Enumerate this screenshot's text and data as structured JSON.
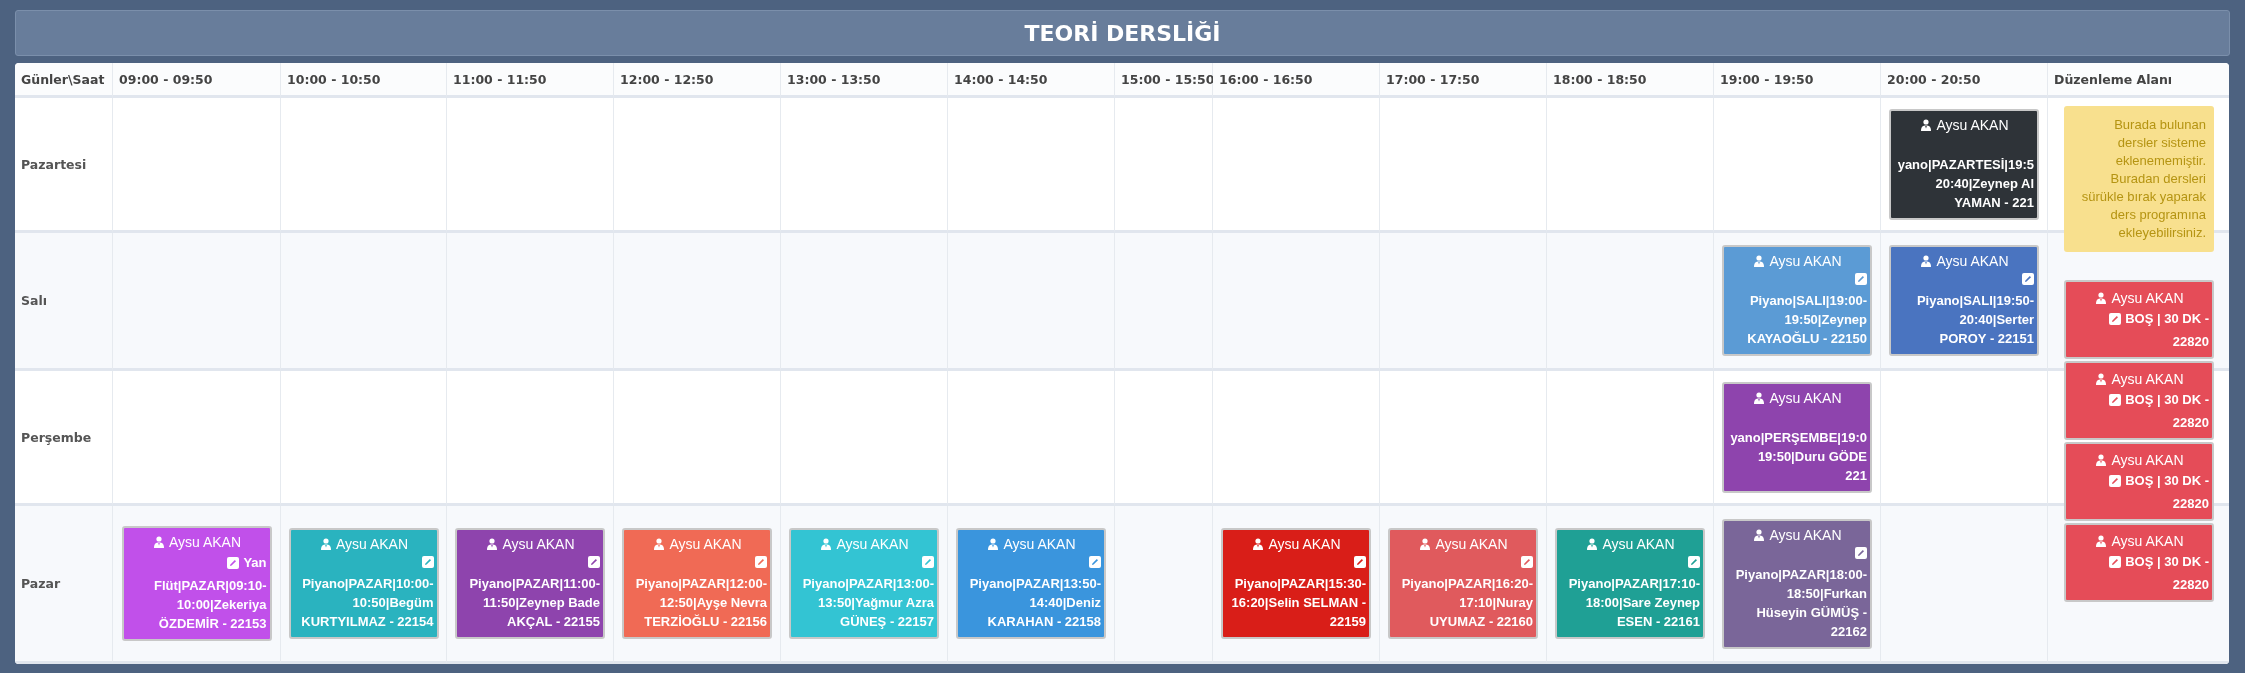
{
  "title": "TEORİ DERSLİĞİ",
  "columns": [
    "Günler\\Saat",
    "09:00 - 09:50",
    "10:00 - 10:50",
    "11:00 - 11:50",
    "12:00 - 12:50",
    "13:00 - 13:50",
    "14:00 - 14:50",
    "15:00 - 15:50",
    "16:00 - 16:50",
    "17:00 - 17:50",
    "18:00 - 18:50",
    "19:00 - 19:50",
    "20:00 - 20:50",
    "Düzenleme Alanı"
  ],
  "rows": [
    {
      "day": "Pazartesi",
      "cells": [
        {},
        {},
        {},
        {},
        {},
        {},
        {},
        {},
        {},
        {},
        {},
        {
          "lesson": {
            "teacher": "Aysu AKAN",
            "kind": "none",
            "color": "#2e3338",
            "text": "yano|PAZARTESİ|19:5\n20:40|Zeynep Al\nYAMAN - 221"
          }
        }
      ]
    },
    {
      "day": "Salı",
      "cells": [
        {},
        {},
        {},
        {},
        {},
        {},
        {},
        {},
        {},
        {},
        {
          "lesson": {
            "teacher": "Aysu AKAN",
            "kind": "own_line",
            "color": "#5b9bd5",
            "text": "Piyano|SALI|19:00-\n19:50|Zeynep\nKAYAOĞLU - 22150"
          }
        },
        {
          "lesson": {
            "teacher": "Aysu AKAN",
            "kind": "own_line",
            "color": "#4a74c0",
            "text": "Piyano|SALI|19:50-\n20:40|Serter\nPOROY - 22151"
          }
        }
      ]
    },
    {
      "day": "Perşembe",
      "cells": [
        {},
        {},
        {},
        {},
        {},
        {},
        {},
        {},
        {},
        {},
        {
          "lesson": {
            "teacher": "Aysu AKAN",
            "kind": "none",
            "color": "#8e44ad",
            "text": "yano|PERŞEMBE|19:0\n19:50|Duru GÖDE\n221"
          }
        },
        {}
      ]
    },
    {
      "day": "Pazar",
      "cells": [
        {
          "lesson": {
            "teacher": "Aysu AKAN",
            "kind": "inline",
            "color": "#c150ea",
            "first_line": "Yan",
            "text": "Flüt|PAZAR|09:10-\n10:00|Zekeriya\nÖZDEMİR - 22153"
          }
        },
        {
          "lesson": {
            "teacher": "Aysu AKAN",
            "kind": "own_line",
            "color": "#2ab3bf",
            "text": "Piyano|PAZAR|10:00-\n10:50|Begüm\nKURTYILMAZ - 22154"
          }
        },
        {
          "lesson": {
            "teacher": "Aysu AKAN",
            "kind": "own_line",
            "color": "#8e44ad",
            "text": "Piyano|PAZAR|11:00-\n11:50|Zeynep Bade\nAKÇAL - 22155"
          }
        },
        {
          "lesson": {
            "teacher": "Aysu AKAN",
            "kind": "own_line",
            "color": "#f06a55",
            "text": "Piyano|PAZAR|12:00-\n12:50|Ayşe Nevra\nTERZİOĞLU - 22156"
          }
        },
        {
          "lesson": {
            "teacher": "Aysu AKAN",
            "kind": "own_line",
            "color": "#33c4d3",
            "text": "Piyano|PAZAR|13:00-\n13:50|Yağmur Azra\nGÜNEŞ - 22157"
          }
        },
        {
          "lesson": {
            "teacher": "Aysu AKAN",
            "kind": "own_line",
            "color": "#3a95dd",
            "text": "Piyano|PAZAR|13:50-\n14:40|Deniz\nKARAHAN - 22158"
          }
        },
        {},
        {
          "lesson": {
            "teacher": "Aysu AKAN",
            "kind": "own_line",
            "color": "#d91e18",
            "text": "Piyano|PAZAR|15:30-\n16:20|Selin SELMAN -\n22159"
          }
        },
        {
          "lesson": {
            "teacher": "Aysu AKAN",
            "kind": "own_line",
            "color": "#e05a5d",
            "text": "Piyano|PAZAR|16:20-\n17:10|Nuray\nUYUMAZ - 22160"
          }
        },
        {
          "lesson": {
            "teacher": "Aysu AKAN",
            "kind": "own_line",
            "color": "#1fa095",
            "text": "Piyano|PAZAR|17:10-\n18:00|Sare Zeynep\nESEN - 22161"
          }
        },
        {
          "lesson": {
            "teacher": "Aysu AKAN",
            "kind": "own_line",
            "color": "#7a6699",
            "text": "Piyano|PAZAR|18:00-\n18:50|Furkan\nHüseyin GÜMÜŞ -\n22162"
          }
        },
        {}
      ]
    }
  ],
  "edit_area": {
    "note": "Burada bulunan dersler sisteme eklenememiştir. Buradan dersleri sürükle bırak yaparak ders programına ekleyebilirsiniz.",
    "lessons": [
      {
        "teacher": "Aysu AKAN",
        "kind": "inline",
        "color": "#e54c58",
        "first_line": "BOŞ | 30 DK -",
        "text": "22820"
      },
      {
        "teacher": "Aysu AKAN",
        "kind": "inline",
        "color": "#e54c58",
        "first_line": "BOŞ | 30 DK -",
        "text": "22820"
      },
      {
        "teacher": "Aysu AKAN",
        "kind": "inline",
        "color": "#e54c58",
        "first_line": "BOŞ | 30 DK -",
        "text": "22820"
      },
      {
        "teacher": "Aysu AKAN",
        "kind": "inline",
        "color": "#e54c58",
        "first_line": "BOŞ | 30 DK -",
        "text": "22820"
      }
    ]
  }
}
